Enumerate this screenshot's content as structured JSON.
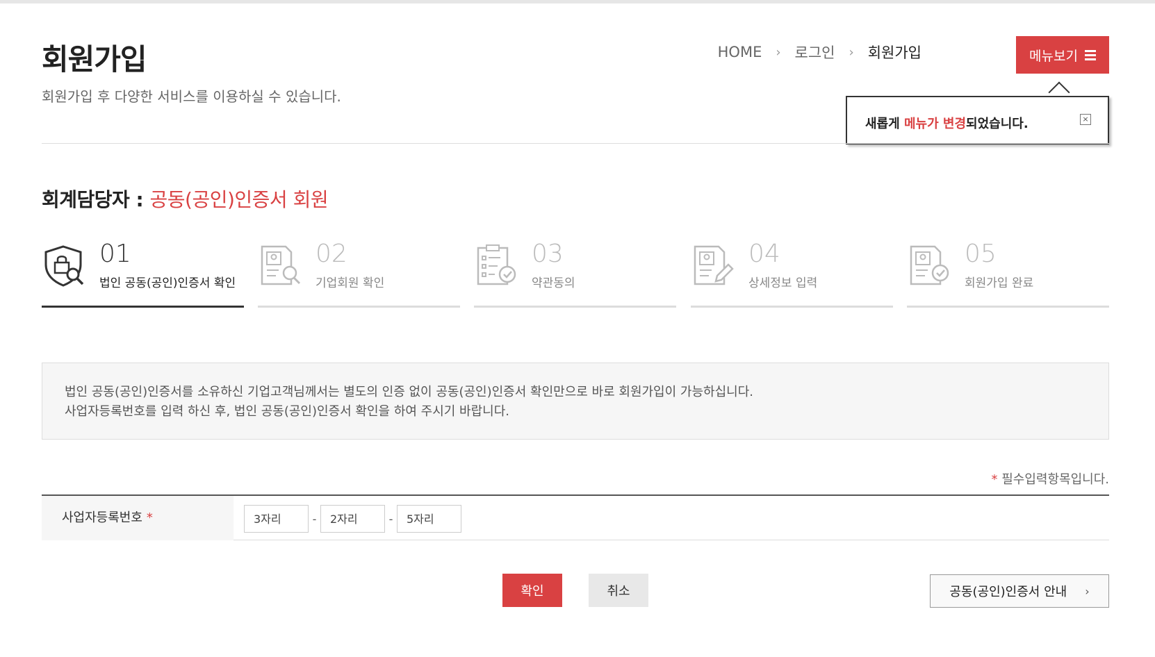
{
  "header": {
    "title": "회원가입",
    "subtitle": "회원가입 후 다양한 서비스를 이용하실 수 있습니다."
  },
  "breadcrumb": {
    "items": [
      "HOME",
      "로그인",
      "회원가입"
    ],
    "separator": "›"
  },
  "menu_button": {
    "label": "메뉴보기"
  },
  "tooltip": {
    "prefix": "새롭게 ",
    "highlight": "메뉴가 변경",
    "suffix": "되었습니다.",
    "close_glyph": "×"
  },
  "section": {
    "label": "회계담당자 : ",
    "highlight": "공동(공인)인증서 회원"
  },
  "steps": [
    {
      "num": "01",
      "label": "법인 공동(공인)인증서 확인",
      "active": true,
      "icon": "shield-lock-search-icon"
    },
    {
      "num": "02",
      "label": "기업회원 확인",
      "active": false,
      "icon": "document-search-icon"
    },
    {
      "num": "03",
      "label": "약관동의",
      "active": false,
      "icon": "checklist-check-icon"
    },
    {
      "num": "04",
      "label": "상세정보 입력",
      "active": false,
      "icon": "document-edit-icon"
    },
    {
      "num": "05",
      "label": "회원가입 완료",
      "active": false,
      "icon": "document-check-icon"
    }
  ],
  "info": {
    "line1": "법인 공동(공인)인증서를 소유하신 기업고객님께서는 별도의 인증 없이 공동(공인)인증서 확인만으로 바로 회원가입이 가능하십니다.",
    "line2": "사업자등록번호를 입력 하신 후, 법인 공동(공인)인증서 확인을 하여 주시기 바랍니다."
  },
  "required_note": {
    "star": "*",
    "text": " 필수입력항목입니다."
  },
  "form": {
    "label": "사업자등록번호",
    "star": "*",
    "dash": "-",
    "field1_placeholder": "3자리",
    "field2_placeholder": "2자리",
    "field3_placeholder": "5자리"
  },
  "buttons": {
    "confirm": "확인",
    "cancel": "취소",
    "guide": "공동(공인)인증서 안내",
    "guide_chevron": "›"
  },
  "colors": {
    "accent": "#d94142",
    "active_step": "#333333",
    "inactive_step": "#dcdcdc"
  }
}
